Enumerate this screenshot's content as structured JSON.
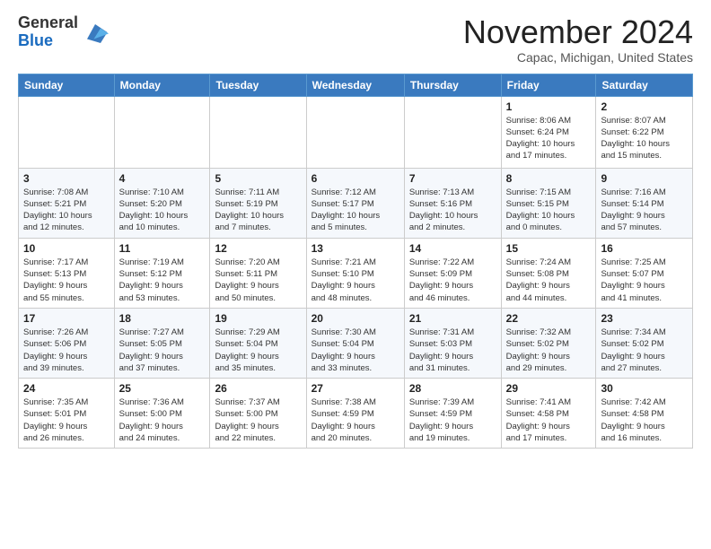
{
  "header": {
    "logo_line1": "General",
    "logo_line2": "Blue",
    "month_title": "November 2024",
    "location": "Capac, Michigan, United States"
  },
  "weekdays": [
    "Sunday",
    "Monday",
    "Tuesday",
    "Wednesday",
    "Thursday",
    "Friday",
    "Saturday"
  ],
  "weeks": [
    [
      {
        "day": "",
        "info": ""
      },
      {
        "day": "",
        "info": ""
      },
      {
        "day": "",
        "info": ""
      },
      {
        "day": "",
        "info": ""
      },
      {
        "day": "",
        "info": ""
      },
      {
        "day": "1",
        "info": "Sunrise: 8:06 AM\nSunset: 6:24 PM\nDaylight: 10 hours\nand 17 minutes."
      },
      {
        "day": "2",
        "info": "Sunrise: 8:07 AM\nSunset: 6:22 PM\nDaylight: 10 hours\nand 15 minutes."
      }
    ],
    [
      {
        "day": "3",
        "info": "Sunrise: 7:08 AM\nSunset: 5:21 PM\nDaylight: 10 hours\nand 12 minutes."
      },
      {
        "day": "4",
        "info": "Sunrise: 7:10 AM\nSunset: 5:20 PM\nDaylight: 10 hours\nand 10 minutes."
      },
      {
        "day": "5",
        "info": "Sunrise: 7:11 AM\nSunset: 5:19 PM\nDaylight: 10 hours\nand 7 minutes."
      },
      {
        "day": "6",
        "info": "Sunrise: 7:12 AM\nSunset: 5:17 PM\nDaylight: 10 hours\nand 5 minutes."
      },
      {
        "day": "7",
        "info": "Sunrise: 7:13 AM\nSunset: 5:16 PM\nDaylight: 10 hours\nand 2 minutes."
      },
      {
        "day": "8",
        "info": "Sunrise: 7:15 AM\nSunset: 5:15 PM\nDaylight: 10 hours\nand 0 minutes."
      },
      {
        "day": "9",
        "info": "Sunrise: 7:16 AM\nSunset: 5:14 PM\nDaylight: 9 hours\nand 57 minutes."
      }
    ],
    [
      {
        "day": "10",
        "info": "Sunrise: 7:17 AM\nSunset: 5:13 PM\nDaylight: 9 hours\nand 55 minutes."
      },
      {
        "day": "11",
        "info": "Sunrise: 7:19 AM\nSunset: 5:12 PM\nDaylight: 9 hours\nand 53 minutes."
      },
      {
        "day": "12",
        "info": "Sunrise: 7:20 AM\nSunset: 5:11 PM\nDaylight: 9 hours\nand 50 minutes."
      },
      {
        "day": "13",
        "info": "Sunrise: 7:21 AM\nSunset: 5:10 PM\nDaylight: 9 hours\nand 48 minutes."
      },
      {
        "day": "14",
        "info": "Sunrise: 7:22 AM\nSunset: 5:09 PM\nDaylight: 9 hours\nand 46 minutes."
      },
      {
        "day": "15",
        "info": "Sunrise: 7:24 AM\nSunset: 5:08 PM\nDaylight: 9 hours\nand 44 minutes."
      },
      {
        "day": "16",
        "info": "Sunrise: 7:25 AM\nSunset: 5:07 PM\nDaylight: 9 hours\nand 41 minutes."
      }
    ],
    [
      {
        "day": "17",
        "info": "Sunrise: 7:26 AM\nSunset: 5:06 PM\nDaylight: 9 hours\nand 39 minutes."
      },
      {
        "day": "18",
        "info": "Sunrise: 7:27 AM\nSunset: 5:05 PM\nDaylight: 9 hours\nand 37 minutes."
      },
      {
        "day": "19",
        "info": "Sunrise: 7:29 AM\nSunset: 5:04 PM\nDaylight: 9 hours\nand 35 minutes."
      },
      {
        "day": "20",
        "info": "Sunrise: 7:30 AM\nSunset: 5:04 PM\nDaylight: 9 hours\nand 33 minutes."
      },
      {
        "day": "21",
        "info": "Sunrise: 7:31 AM\nSunset: 5:03 PM\nDaylight: 9 hours\nand 31 minutes."
      },
      {
        "day": "22",
        "info": "Sunrise: 7:32 AM\nSunset: 5:02 PM\nDaylight: 9 hours\nand 29 minutes."
      },
      {
        "day": "23",
        "info": "Sunrise: 7:34 AM\nSunset: 5:02 PM\nDaylight: 9 hours\nand 27 minutes."
      }
    ],
    [
      {
        "day": "24",
        "info": "Sunrise: 7:35 AM\nSunset: 5:01 PM\nDaylight: 9 hours\nand 26 minutes."
      },
      {
        "day": "25",
        "info": "Sunrise: 7:36 AM\nSunset: 5:00 PM\nDaylight: 9 hours\nand 24 minutes."
      },
      {
        "day": "26",
        "info": "Sunrise: 7:37 AM\nSunset: 5:00 PM\nDaylight: 9 hours\nand 22 minutes."
      },
      {
        "day": "27",
        "info": "Sunrise: 7:38 AM\nSunset: 4:59 PM\nDaylight: 9 hours\nand 20 minutes."
      },
      {
        "day": "28",
        "info": "Sunrise: 7:39 AM\nSunset: 4:59 PM\nDaylight: 9 hours\nand 19 minutes."
      },
      {
        "day": "29",
        "info": "Sunrise: 7:41 AM\nSunset: 4:58 PM\nDaylight: 9 hours\nand 17 minutes."
      },
      {
        "day": "30",
        "info": "Sunrise: 7:42 AM\nSunset: 4:58 PM\nDaylight: 9 hours\nand 16 minutes."
      }
    ]
  ]
}
